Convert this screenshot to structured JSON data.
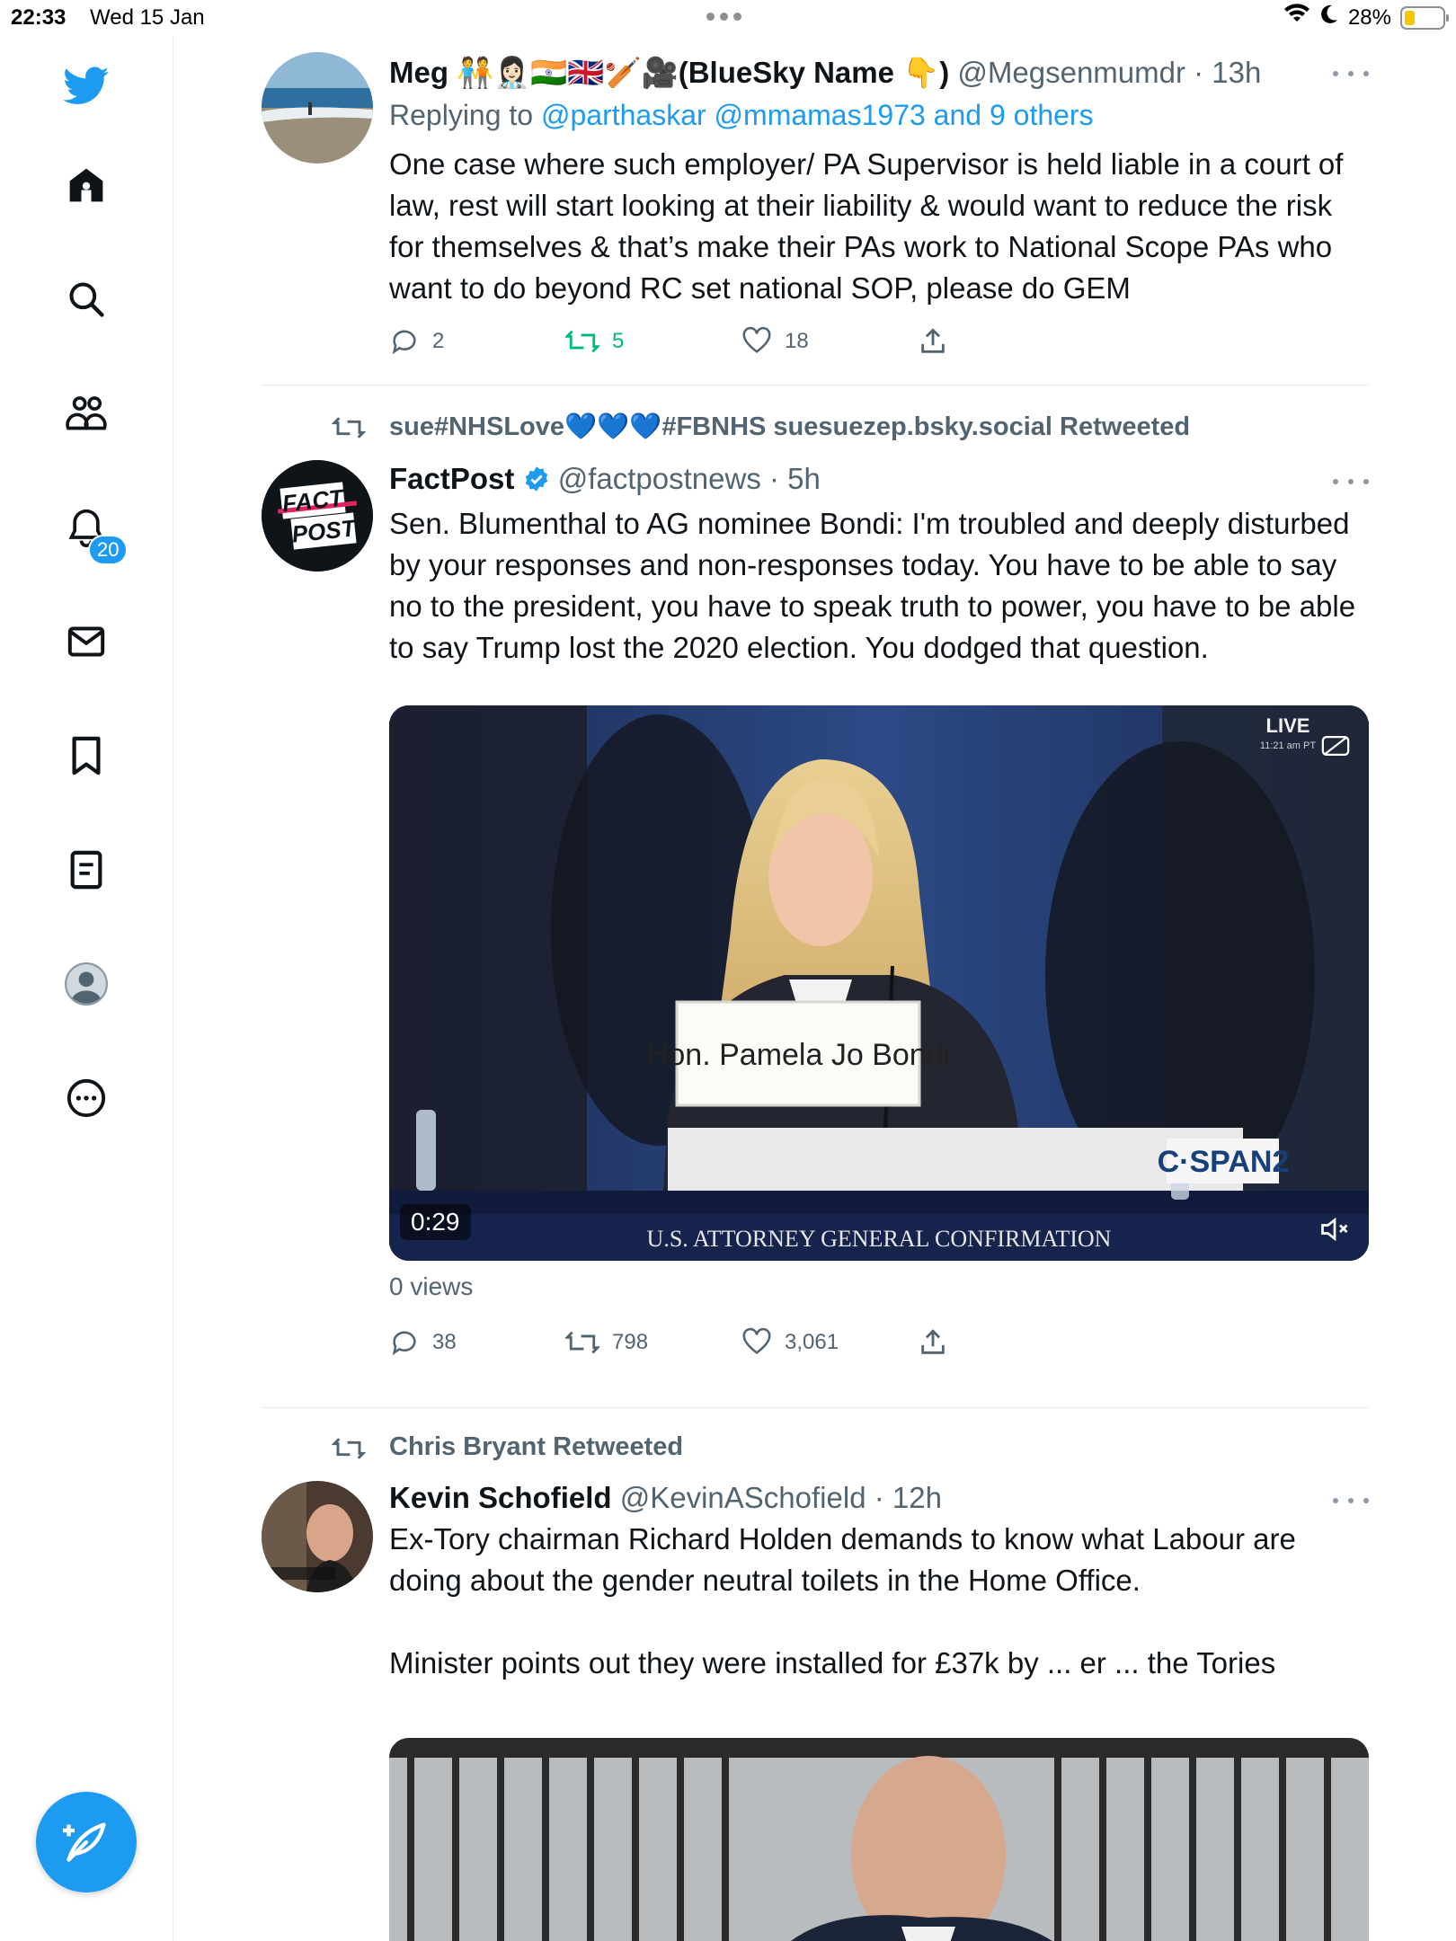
{
  "status_bar": {
    "time": "22:33",
    "date": "Wed 15 Jan",
    "battery": "28%"
  },
  "sidebar": {
    "items": [
      {
        "name": "logo"
      },
      {
        "name": "home"
      },
      {
        "name": "search"
      },
      {
        "name": "communities"
      },
      {
        "name": "notifications"
      },
      {
        "name": "messages"
      },
      {
        "name": "bookmarks"
      },
      {
        "name": "lists"
      },
      {
        "name": "profile"
      },
      {
        "name": "more"
      }
    ],
    "notification_badge": "20"
  },
  "tweets": [
    {
      "name": "Meg 🧑‍🤝‍🧑👩🏻‍⚕️🇮🇳🇬🇧🏏🎥(BlueSky Name 👇)",
      "handle": "@Megsenmumdr",
      "time": "· 13h",
      "reply_prefix": "Replying to ",
      "reply_to": "@parthaskar @mmamas1973 and 9 others",
      "text": "One case where such employer/ PA Supervisor is held liable in a court of law, rest will start looking at their liability & would want to reduce the risk for themselves & that’s make their PAs work to National Scope PAs who want to do beyond RC set national SOP, please do GEM",
      "replies": "2",
      "retweets": "5",
      "likes": "18"
    },
    {
      "retweeted_by": "sue#NHSLove💙💙💙#FBNHS suesuezep.bsky.social Retweeted",
      "name": "FactPost",
      "handle": "@factpostnews",
      "time": "· 5h",
      "avatar_text_1": "FACT",
      "avatar_text_2": "POST",
      "text": "Sen. Blumenthal to AG nominee Bondi: I'm troubled and deeply disturbed by your responses and non-responses today. You have to be able to say no to the president, you have to speak truth to power, you have to be able to say Trump lost the 2020 election. You dodged that question.",
      "video": {
        "live": "LIVE",
        "live_time": "11:21 am PT",
        "nameplate": "Hon. Pamela Jo Bondi",
        "network": "C·SPAN2",
        "banner": "U.S. ATTORNEY GENERAL CONFIRMATION",
        "duration": "0:29"
      },
      "views": "0 views",
      "replies": "38",
      "retweets": "798",
      "likes": "3,061"
    },
    {
      "retweeted_by": "Chris Bryant Retweeted",
      "name": "Kevin Schofield",
      "handle": "@KevinASchofield",
      "time": "· 12h",
      "text": "Ex-Tory chairman Richard Holden demands to know what Labour are doing about the gender neutral toilets in the Home Office.\n\nMinister points out they were installed for £37k by ... er ... the Tories"
    }
  ]
}
